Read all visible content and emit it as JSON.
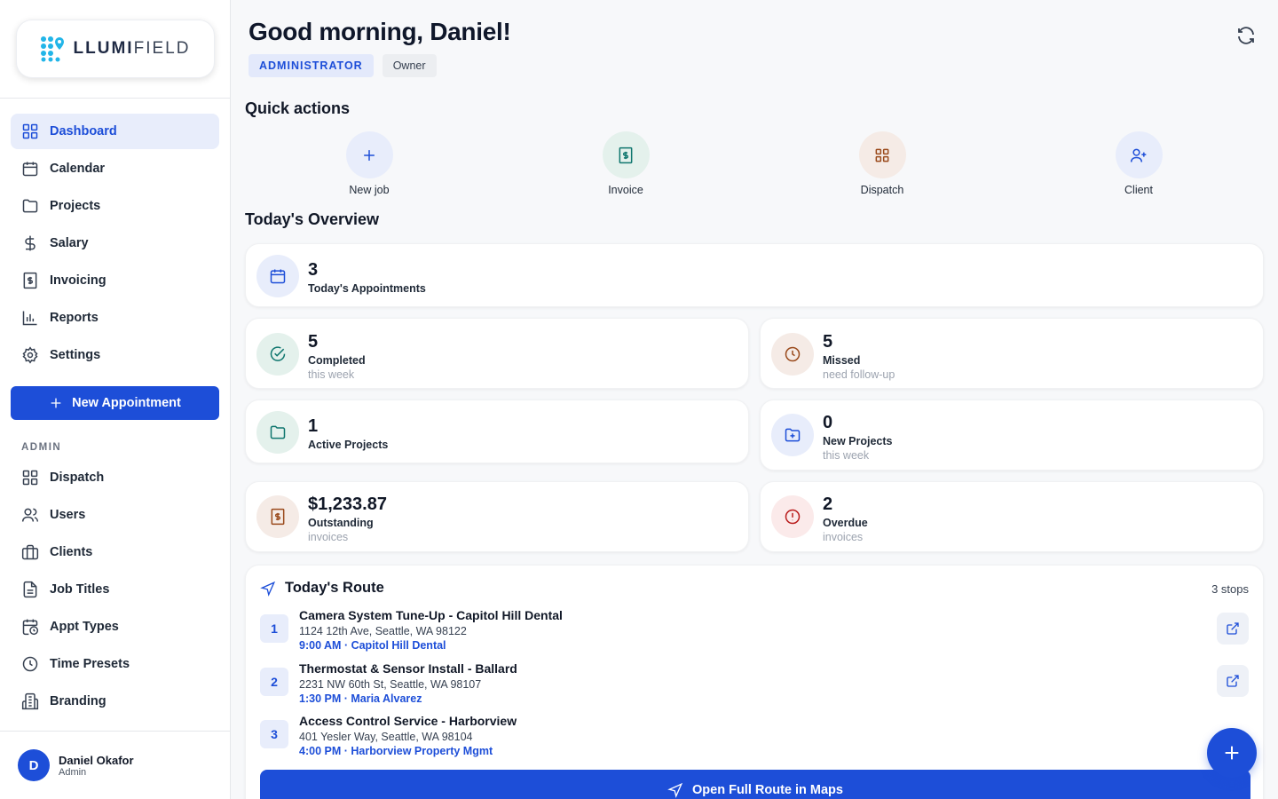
{
  "brand": {
    "name_bold": "LLUMI",
    "name_thin": "FIELD"
  },
  "sidebar": {
    "items": [
      {
        "label": "Dashboard",
        "icon": "grid-icon",
        "active": true
      },
      {
        "label": "Calendar",
        "icon": "calendar-icon"
      },
      {
        "label": "Projects",
        "icon": "folder-icon"
      },
      {
        "label": "Salary",
        "icon": "dollar-icon"
      },
      {
        "label": "Invoicing",
        "icon": "invoice-icon"
      },
      {
        "label": "Reports",
        "icon": "bar-chart-icon"
      },
      {
        "label": "Settings",
        "icon": "gear-icon"
      }
    ],
    "new_appointment_label": "New Appointment",
    "admin_section_label": "ADMIN",
    "admin_items": [
      {
        "label": "Dispatch",
        "icon": "grid-icon"
      },
      {
        "label": "Users",
        "icon": "users-icon"
      },
      {
        "label": "Clients",
        "icon": "briefcase-icon"
      },
      {
        "label": "Job Titles",
        "icon": "document-icon"
      },
      {
        "label": "Appt Types",
        "icon": "calendar-clock-icon"
      },
      {
        "label": "Time Presets",
        "icon": "clock-icon"
      },
      {
        "label": "Branding",
        "icon": "building-icon"
      }
    ],
    "user": {
      "initial": "D",
      "name": "Daniel Okafor",
      "role": "Admin"
    }
  },
  "header": {
    "greeting": "Good morning, Daniel!",
    "role_badge": "ADMINISTRATOR",
    "owner_badge": "Owner"
  },
  "quick_actions": {
    "title": "Quick actions",
    "items": [
      {
        "label": "New job",
        "icon": "plus-icon",
        "color": "#1d4ed8",
        "bg": "#e8edfb"
      },
      {
        "label": "Invoice",
        "icon": "invoice-icon",
        "color": "#0f766e",
        "bg": "#e4f1ec"
      },
      {
        "label": "Dispatch",
        "icon": "grid-icon",
        "color": "#9a4a1c",
        "bg": "#f5ebe6"
      },
      {
        "label": "Client",
        "icon": "user-plus-icon",
        "color": "#1d4ed8",
        "bg": "#e8edfb"
      }
    ]
  },
  "overview": {
    "title": "Today's Overview",
    "appointments": {
      "value": "3",
      "label": "Today's Appointments"
    },
    "completed": {
      "value": "5",
      "label": "Completed",
      "sub": "this week"
    },
    "missed": {
      "value": "5",
      "label": "Missed",
      "sub": "need follow-up"
    },
    "active_projects": {
      "value": "1",
      "label": "Active Projects"
    },
    "new_projects": {
      "value": "0",
      "label": "New Projects",
      "sub": "this week"
    },
    "outstanding": {
      "value": "$1,233.87",
      "label": "Outstanding",
      "sub": "invoices"
    },
    "overdue": {
      "value": "2",
      "label": "Overdue",
      "sub": "invoices"
    }
  },
  "route": {
    "title": "Today's Route",
    "stops_count": "3 stops",
    "stops": [
      {
        "num": "1",
        "title": "Camera System Tune-Up - Capitol Hill Dental",
        "address": "1124 12th Ave, Seattle, WA 98122",
        "meta": "9:00 AM · Capitol Hill Dental"
      },
      {
        "num": "2",
        "title": "Thermostat & Sensor Install - Ballard",
        "address": "2231 NW 60th St, Seattle, WA 98107",
        "meta": "1:30 PM · Maria Alvarez"
      },
      {
        "num": "3",
        "title": "Access Control Service - Harborview",
        "address": "401 Yesler Way, Seattle, WA 98104",
        "meta": "4:00 PM · Harborview Property Mgmt"
      }
    ],
    "open_maps_label": "Open Full Route in Maps"
  },
  "colors": {
    "accent": "#1d4ed8",
    "green": "#0f766e",
    "brown": "#9a4a1c",
    "red": "#b91c1c"
  }
}
